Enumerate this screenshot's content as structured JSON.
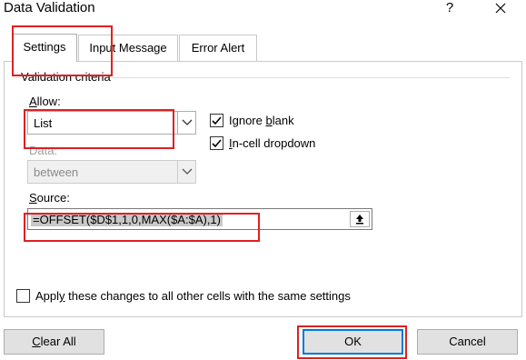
{
  "window": {
    "title": "Data Validation",
    "help_glyph": "?",
    "close_icon": "close-icon"
  },
  "tabs": [
    {
      "label": "Settings",
      "selected": true
    },
    {
      "label": "Input Message",
      "selected": false
    },
    {
      "label": "Error Alert",
      "selected": false
    }
  ],
  "criteria": {
    "legend": "Validation criteria",
    "allow_label": "Allow:",
    "allow_value": "List",
    "data_label": "Data:",
    "data_value": "between",
    "ignore_blank_label": "Ignore blank",
    "ignore_blank_checked": true,
    "in_cell_dropdown_label": "In-cell dropdown",
    "in_cell_dropdown_checked": true,
    "source_label": "Source:",
    "source_value": "=OFFSET($D$1,1,0,MAX($A:$A),1)"
  },
  "apply_all": {
    "label": "Apply these changes to all other cells with the same settings",
    "checked": false
  },
  "buttons": {
    "clear_all": "Clear All",
    "ok": "OK",
    "cancel": "Cancel"
  },
  "colors": {
    "annotation": "#e02020",
    "ok_focus": "#0078d7"
  }
}
